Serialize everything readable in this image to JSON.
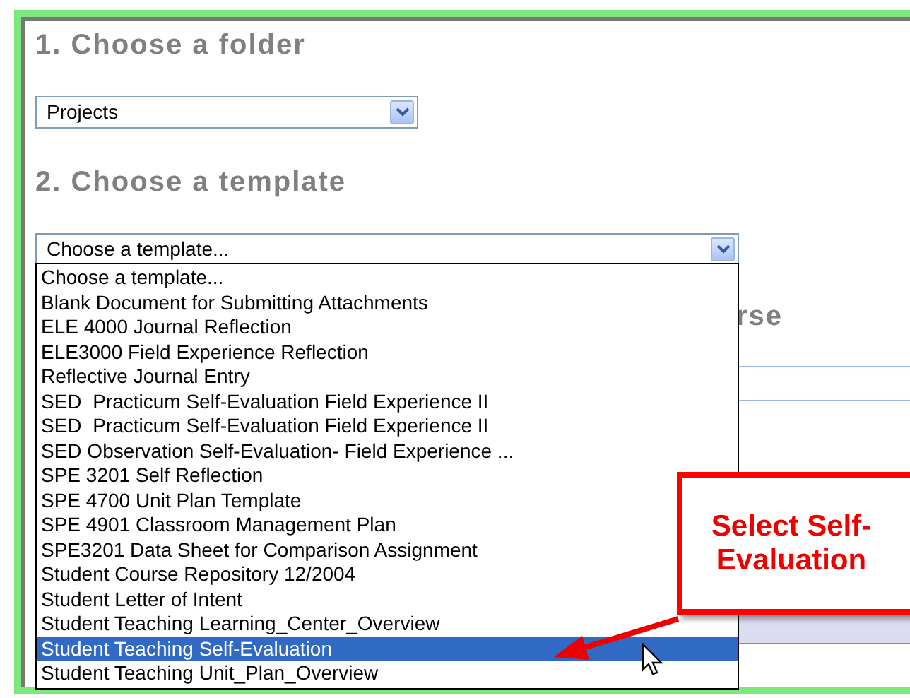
{
  "folder_section": {
    "heading": "1. Choose a folder",
    "select": {
      "value": "Projects"
    }
  },
  "template_section": {
    "heading": "2. Choose a template",
    "select": {
      "value": "Choose a template...",
      "expanded": true
    },
    "options": [
      {
        "label": "Choose a template...",
        "selected": false
      },
      {
        "label": "Blank Document for Submitting Attachments",
        "selected": false
      },
      {
        "label": "ELE 4000 Journal Reflection",
        "selected": false
      },
      {
        "label": "ELE3000 Field Experience Reflection",
        "selected": false
      },
      {
        "label": "Reflective Journal Entry",
        "selected": false
      },
      {
        "label": "SED  Practicum Self-Evaluation Field Experience II",
        "selected": false
      },
      {
        "label": "SED  Practicum Self-Evaluation Field Experience II",
        "selected": false
      },
      {
        "label": "SED Observation Self-Evaluation- Field Experience ...",
        "selected": false
      },
      {
        "label": "SPE 3201 Self Reflection",
        "selected": false
      },
      {
        "label": "SPE 4700 Unit Plan Template",
        "selected": false
      },
      {
        "label": "SPE 4901 Classroom Management Plan",
        "selected": false
      },
      {
        "label": "SPE3201 Data Sheet for Comparison Assignment",
        "selected": false
      },
      {
        "label": "Student Course Repository 12/2004",
        "selected": false
      },
      {
        "label": "Student Letter of Intent",
        "selected": false
      },
      {
        "label": "Student Teaching Learning_Center_Overview",
        "selected": false
      },
      {
        "label": "Student Teaching Self-Evaluation",
        "selected": true
      },
      {
        "label": "Student Teaching Unit_Plan_Overview",
        "selected": false
      }
    ]
  },
  "covered_heading": {
    "text": "rse"
  },
  "callout": {
    "lines": [
      "Select Self-",
      "Evaluation"
    ]
  }
}
